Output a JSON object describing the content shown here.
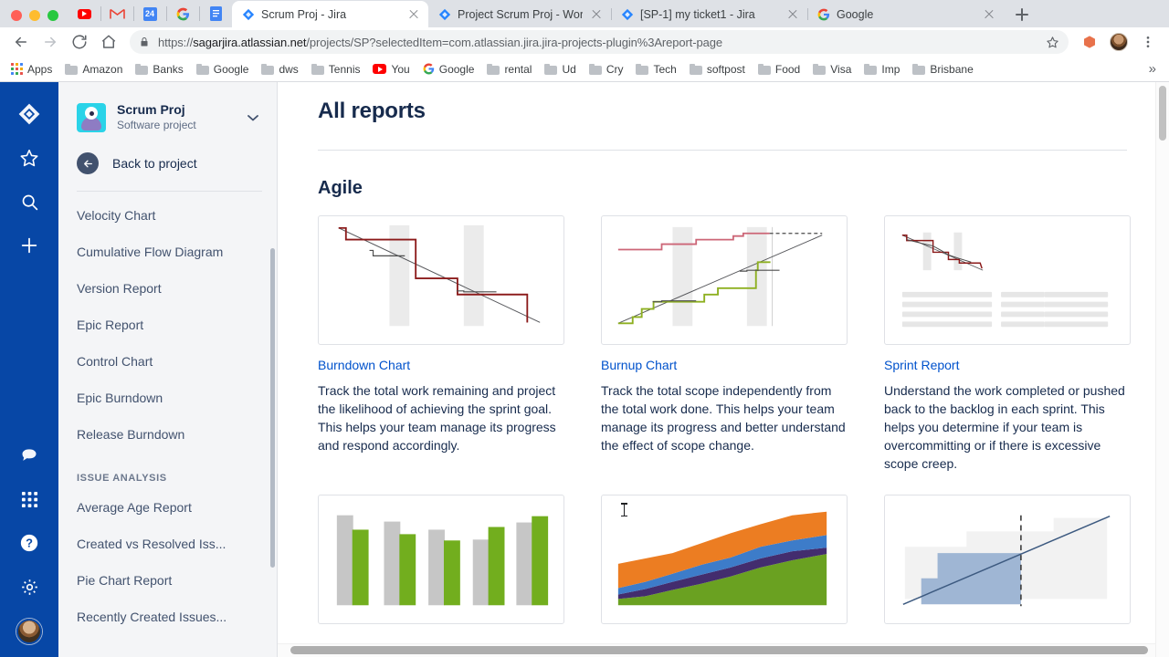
{
  "browser": {
    "window_controls": [
      "close",
      "minimize",
      "maximize"
    ],
    "pinned_tabs": [
      {
        "name": "youtube-pinned-tab",
        "icon": "youtube-icon"
      },
      {
        "name": "gmail-pinned-tab",
        "icon": "gmail-icon"
      },
      {
        "name": "calendar-pinned-tab",
        "icon": "calendar-icon",
        "label": "24"
      },
      {
        "name": "google-pinned-tab",
        "icon": "google-icon"
      },
      {
        "name": "docs-pinned-tab",
        "icon": "google-docs-icon"
      }
    ],
    "tabs": [
      {
        "title": "Scrum Proj - Jira",
        "icon": "jira-icon",
        "active": true
      },
      {
        "title": "Project Scrum Proj - Workflow",
        "icon": "jira-icon",
        "active": false
      },
      {
        "title": "[SP-1] my ticket1 - Jira",
        "icon": "jira-icon",
        "active": false
      },
      {
        "title": "Google",
        "icon": "google-icon",
        "active": false
      }
    ],
    "new_tab_label": "+",
    "toolbar": {
      "back": "←",
      "forward": "→",
      "reload": "↻",
      "home": "⌂",
      "lock_icon": "lock-icon",
      "url_scheme": "https://",
      "url_host": "sagarjira.atlassian.net",
      "url_path": "/projects/SP?selectedItem=com.atlassian.jira.jira-projects-plugin%3Areport-page",
      "star_icon": "bookmark-star-icon",
      "extension_icon": "extension-icon",
      "menu_icon": "kebab-menu-icon"
    },
    "bookmarks": [
      {
        "label": "Apps",
        "icon": "apps-grid-icon"
      },
      {
        "label": "Amazon",
        "icon": "folder-icon"
      },
      {
        "label": "Banks",
        "icon": "folder-icon"
      },
      {
        "label": "Google",
        "icon": "folder-icon"
      },
      {
        "label": "dws",
        "icon": "folder-icon"
      },
      {
        "label": "Tennis",
        "icon": "folder-icon"
      },
      {
        "label": "You",
        "icon": "youtube-icon"
      },
      {
        "label": "Google",
        "icon": "google-icon"
      },
      {
        "label": "rental",
        "icon": "folder-icon"
      },
      {
        "label": "Ud",
        "icon": "folder-icon"
      },
      {
        "label": "Cry",
        "icon": "folder-icon"
      },
      {
        "label": "Tech",
        "icon": "folder-icon"
      },
      {
        "label": "softpost",
        "icon": "folder-icon"
      },
      {
        "label": "Food",
        "icon": "folder-icon"
      },
      {
        "label": "Visa",
        "icon": "folder-icon"
      },
      {
        "label": "Imp",
        "icon": "folder-icon"
      },
      {
        "label": "Brisbane",
        "icon": "folder-icon"
      }
    ],
    "bookmarks_overflow": "»"
  },
  "rail": {
    "items": [
      {
        "name": "jira-logo-icon"
      },
      {
        "name": "starred-icon"
      },
      {
        "name": "search-icon"
      },
      {
        "name": "create-icon"
      }
    ],
    "bottom_items": [
      {
        "name": "feedback-icon"
      },
      {
        "name": "app-switcher-icon"
      },
      {
        "name": "help-icon"
      },
      {
        "name": "settings-icon"
      },
      {
        "name": "user-avatar"
      }
    ]
  },
  "sidebar": {
    "project_name": "Scrum Proj",
    "project_type": "Software project",
    "project_chevron": "⌄",
    "back_label": "Back to project",
    "nav_items": [
      "Velocity Chart",
      "Cumulative Flow Diagram",
      "Version Report",
      "Epic Report",
      "Control Chart",
      "Epic Burndown",
      "Release Burndown"
    ],
    "section_label": "ISSUE ANALYSIS",
    "section_items": [
      "Average Age Report",
      "Created vs Resolved Iss...",
      "Pie Chart Report",
      "Recently Created Issues..."
    ]
  },
  "main": {
    "page_title": "All reports",
    "sections": [
      {
        "title": "Agile",
        "cards": [
          {
            "title": "Burndown Chart",
            "description": "Track the total work remaining and project the likelihood of achieving the sprint goal. This helps your team manage its progress and respond accordingly.",
            "thumb": "burndown-thumb"
          },
          {
            "title": "Burnup Chart",
            "description": "Track the total scope independently from the total work done. This helps your team manage its progress and better understand the effect of scope change.",
            "thumb": "burnup-thumb"
          },
          {
            "title": "Sprint Report",
            "description": "Understand the work completed or pushed back to the backlog in each sprint. This helps you determine if your team is overcommitting or if there is excessive scope creep.",
            "thumb": "sprint-report-thumb"
          },
          {
            "title": "",
            "description": "",
            "thumb": "velocity-thumb"
          },
          {
            "title": "",
            "description": "",
            "thumb": "cumulative-flow-thumb"
          },
          {
            "title": "",
            "description": "",
            "thumb": "version-report-thumb"
          }
        ]
      }
    ]
  },
  "colors": {
    "jira_blue": "#0747a6",
    "link_blue": "#0052cc",
    "text_dark": "#172b4d",
    "text_muted": "#5e6c84",
    "sidebar_bg": "#f4f5f7",
    "border": "#dfe1e6",
    "burndown_red": "#8b1a1a",
    "burnup_green": "#8eb021",
    "burnup_pink": "#cc6677",
    "cfd_green": "#6aa121",
    "cfd_purple": "#432d6e",
    "cfd_blue": "#3d7cc9",
    "cfd_orange": "#ec7d22",
    "version_blue": "#9fb6d4"
  }
}
